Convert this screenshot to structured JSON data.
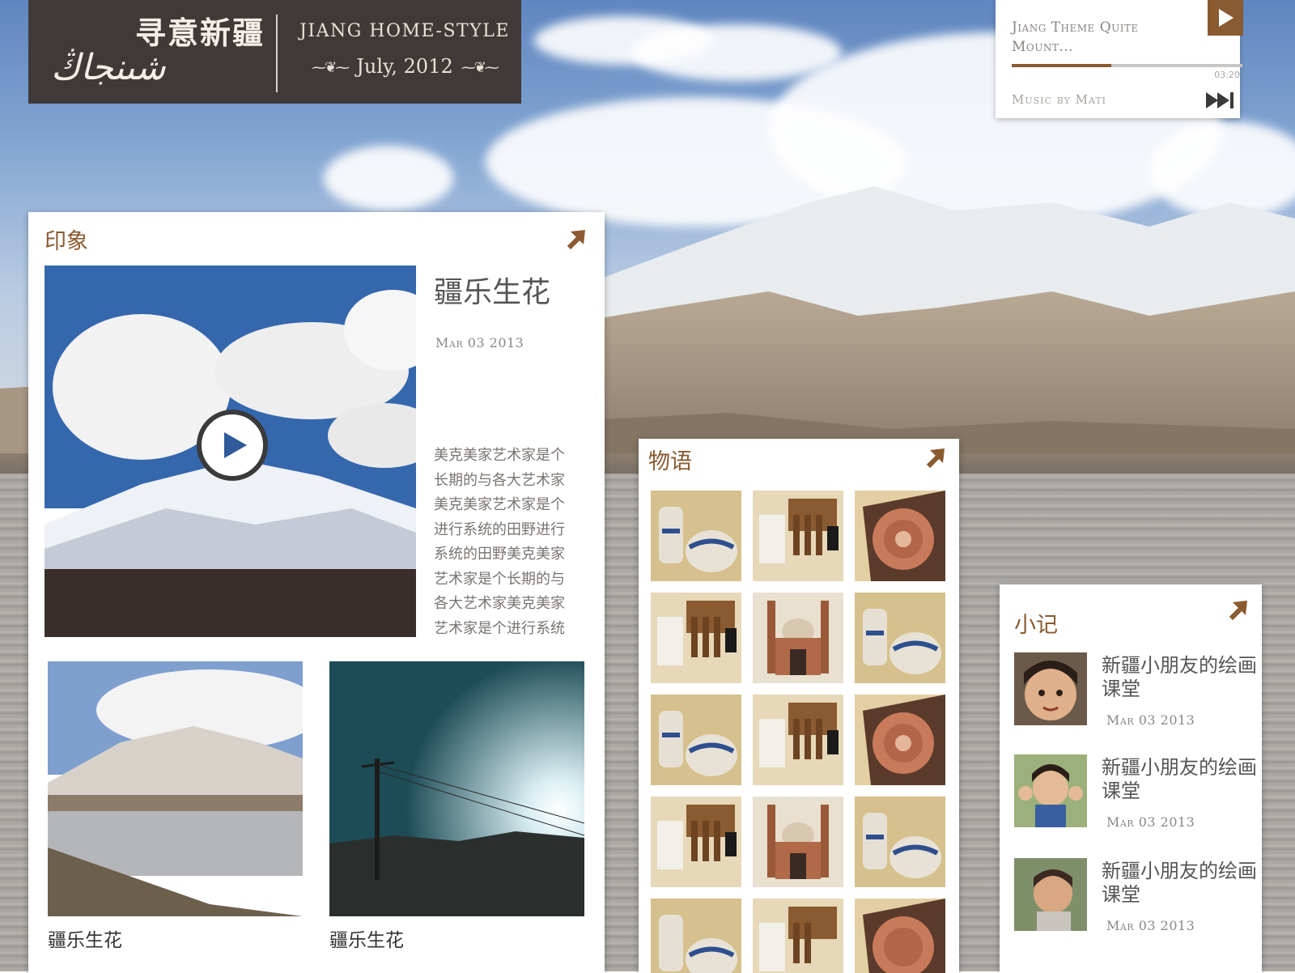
{
  "header": {
    "logo_cn": "寻意新疆",
    "logo_script": "شىنجاڭ",
    "title": "Jiang Home-Style",
    "date": "July, 2012"
  },
  "player": {
    "track": "Jiang Theme Quite Mount...",
    "time": "03:20",
    "credit": "Music by Mati",
    "progress": 0.43
  },
  "impression": {
    "heading": "印象",
    "feature": {
      "title": "疆乐生花",
      "date": "Mar 03 2013",
      "body": [
        "美克美家艺术家是个",
        "长期的与各大艺术家",
        "美克美家艺术家是个",
        "进行系统的田野进行",
        "系统的田野美克美家",
        "艺术家是个长期的与",
        "各大艺术家美克美家",
        "艺术家是个进行系统"
      ]
    },
    "thumbs": [
      {
        "caption": "疆乐生花"
      },
      {
        "caption": "疆乐生花"
      }
    ]
  },
  "stories": {
    "heading": "物语"
  },
  "notes": {
    "heading": "小记",
    "items": [
      {
        "title": "新疆小朋友的绘画课堂",
        "date": "Mar 03 2013"
      },
      {
        "title": "新疆小朋友的绘画课堂",
        "date": "Mar 03 2013"
      },
      {
        "title": "新疆小朋友的绘画课堂",
        "date": "Mar 03 2013"
      }
    ]
  },
  "colors": {
    "accent": "#8a5a30",
    "header_bg": "#3f3a38"
  }
}
